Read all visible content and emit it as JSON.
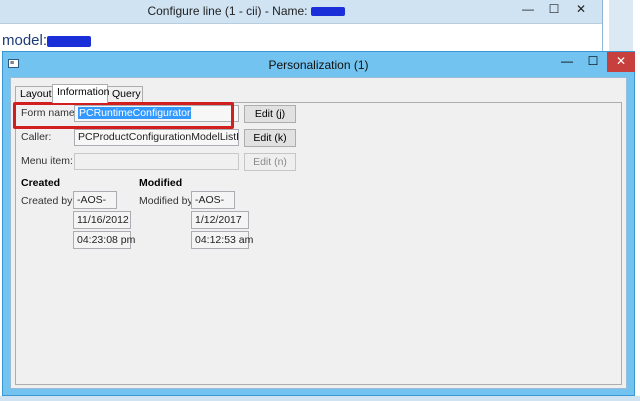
{
  "parent_window": {
    "title": "Configure line (1 - cii) - Name:",
    "model_label": "model:",
    "controls": {
      "minimize": "—",
      "maximize": "☐",
      "close": "✕"
    }
  },
  "dialog": {
    "title": "Personalization (1)",
    "controls": {
      "minimize": "—",
      "maximize": "☐",
      "close": "✕"
    },
    "tabs": [
      {
        "label": "Layout"
      },
      {
        "label": "Information"
      },
      {
        "label": "Query"
      }
    ],
    "active_tab": "Information",
    "form_name": {
      "label": "Form name:",
      "value": "PCRuntimeConfigurator",
      "button": "Edit (j)"
    },
    "caller": {
      "label": "Caller:",
      "value": "PCProductConfigurationModelListPag",
      "button": "Edit (k)"
    },
    "menu_item": {
      "label": "Menu item:",
      "value": "",
      "button": "Edit (n)"
    },
    "created": {
      "heading": "Created",
      "by_label": "Created by:",
      "by": "-AOS-",
      "date": "11/16/2012",
      "time": "04:23:08 pm"
    },
    "modified": {
      "heading": "Modified",
      "by_label": "Modified by:",
      "by": "-AOS-",
      "date": "1/12/2017",
      "time": "04:12:53 am"
    }
  },
  "colors": {
    "dialog_frame": "#72c3ef",
    "close_button": "#c8403d",
    "highlight_box": "#d11f1f",
    "selection": "#3399ff"
  }
}
